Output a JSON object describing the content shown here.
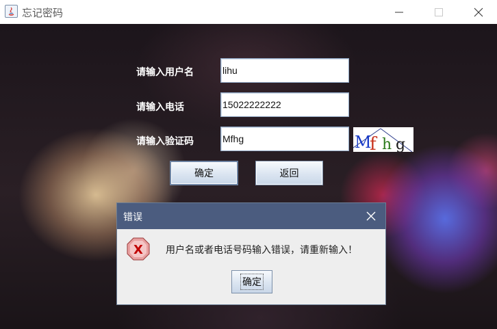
{
  "window": {
    "title": "忘记密码"
  },
  "form": {
    "username_label": "请输入用户名",
    "username_value": "lihu",
    "phone_label": "请输入电话",
    "phone_value": "15022222222",
    "captcha_label": "请输入验证码",
    "captcha_value": "Mfhg",
    "captcha_image_text": "Mfhg",
    "confirm_label": "确定",
    "back_label": "返回"
  },
  "dialog": {
    "title": "错误",
    "message": "用户名或者电话号码输入错误，请重新输入！",
    "ok_label": "确定",
    "icon": "error-icon"
  },
  "colors": {
    "dialog_title_bg": "#4b5c7f",
    "error_icon": "#d9534f"
  }
}
